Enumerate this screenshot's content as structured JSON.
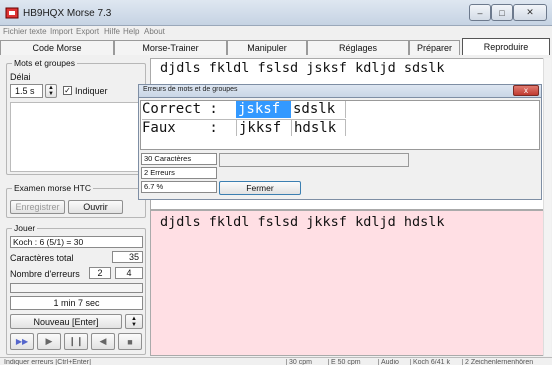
{
  "window": {
    "title": "HB9HQX Morse 7.3"
  },
  "menu": [
    "Fichier texte",
    "Import",
    "Export",
    "Hilfe",
    "Help",
    "About"
  ],
  "tabs": [
    "Code Morse",
    "Morse-Trainer",
    "Manipuler",
    "Réglages",
    "Préparer",
    "Reproduire"
  ],
  "left": {
    "group_mots": "Mots et groupes",
    "delai_label": "Délai",
    "delai_value": "1.5 s",
    "indiquer_label": "Indiquer",
    "group_examen": "Examen morse HTC",
    "enregistrer": "Enregistrer",
    "ouvrir": "Ouvrir",
    "group_jouer": "Jouer",
    "koch": "Koch : 6 (5/1) = 30",
    "caracteres_label": "Caractères total",
    "caracteres_value": "35",
    "erreurs_label": "Nombre d'erreurs",
    "erreurs_a": "2",
    "erreurs_b": "4",
    "time": "1 min 7 sec",
    "nouveau": "Nouveau  [Enter]"
  },
  "main": {
    "expected_text": "djdls fkldl fslsd jsksf kdljd sdslk",
    "typed_text": "djdls fkldl fslsd jkksf kdljd hdslk"
  },
  "dialog": {
    "title": "Erreurs de mots et de groupes",
    "correct_label": "Correct :",
    "correct_word1": "jsksf",
    "correct_word2": "sdslk",
    "faux_label": "Faux    :",
    "faux_word1": "jkksf",
    "faux_word2": "hdslk",
    "stat_caracteres": "30 Caractères",
    "stat_erreurs": "2 Erreurs",
    "stat_percent": "6.7 %",
    "fermer": "Fermer",
    "close_glyph": "x"
  },
  "statusbar": [
    "Indiquer erreurs  [Ctrl+Enter]",
    "30 cpm",
    "E 50 cpm",
    "Audio",
    "Koch 6/41 k",
    "2 Zeichenlernenhören"
  ],
  "colors": {
    "selection": "#3399ff",
    "typed_bg": "#ffdfe4",
    "close_red": "#c8413a"
  }
}
